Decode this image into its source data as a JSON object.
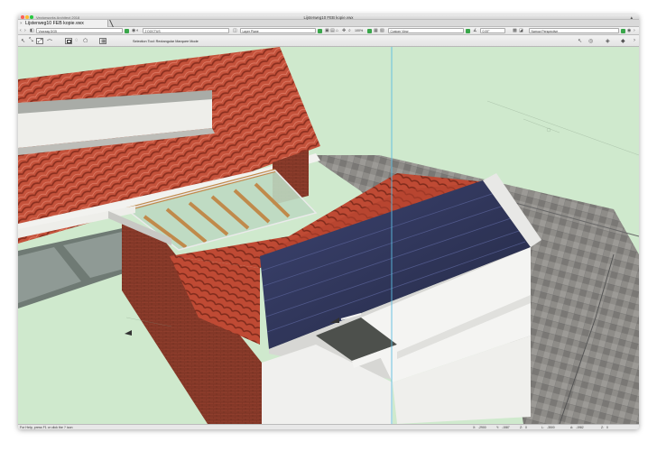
{
  "window": {
    "app_name": "Vectorworks Architect 2018",
    "doc_title": "Lijsterweg10 FEB  kopie.vwx",
    "share_icon": "person-icon"
  },
  "tab": {
    "label": "Lijsterweg10 FEB  kopie.vwx",
    "close_glyph": "×"
  },
  "viewbar": {
    "layer_field": "Voorzag DG5",
    "class_field": "2 DOCTUS",
    "plane_field": "Layer Plane",
    "zoom": "100%",
    "view_field": "Custom View",
    "angle_field": "0.00°",
    "projection_field": "Narrow Perspective"
  },
  "toolbar": {
    "hint": "Selection Tool: Rectangular Marquee Mode"
  },
  "status": {
    "hint": "For Help, press F1 or click the ? icon",
    "x_label": "X:",
    "x_value": "-2900",
    "y_label": "Y:",
    "y_value": "-1587",
    "z_label": "Z:",
    "z_value": "0",
    "l_label": "L:",
    "l_value": "-3500",
    "a_label": "A:",
    "a_value": "-1982",
    "b_label": "Z:",
    "b_value": "0"
  },
  "colors": {
    "background": "#cfe9cd",
    "roof_tiles": "#c14e38",
    "solar_panel": "#2c3254",
    "brick": "#8a3a2a",
    "wall_white": "#f4f4f2",
    "pavement": "#8c8a86",
    "guide_line": "#5bbde0"
  }
}
